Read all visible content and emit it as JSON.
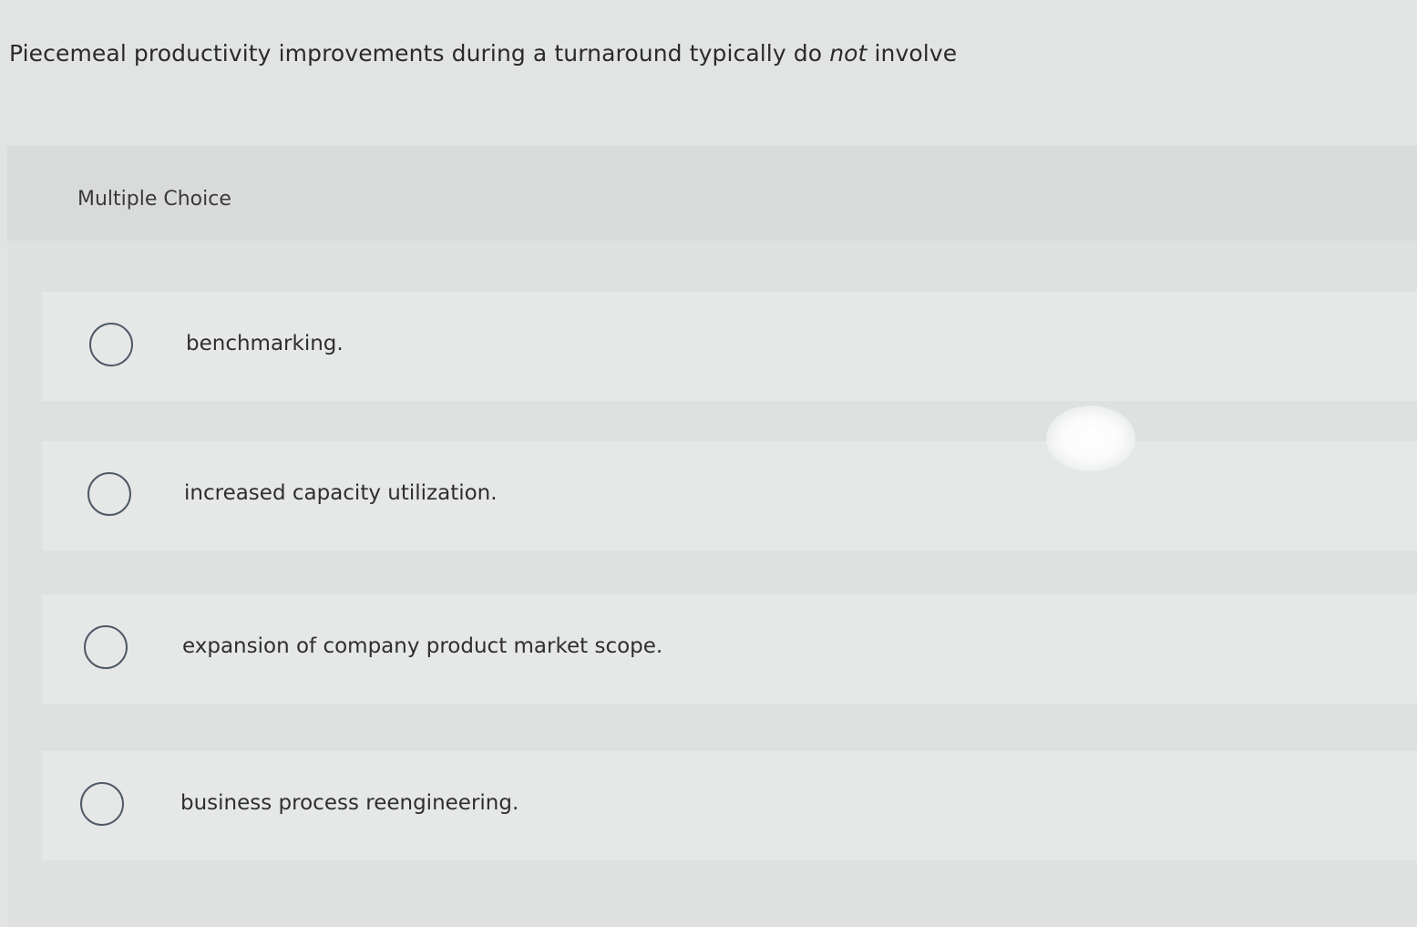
{
  "question": {
    "text_before": "Piecemeal productivity improvements during a turnaround typically do ",
    "emphasis": "not",
    "text_after": " involve"
  },
  "section": {
    "label": "Multiple Choice"
  },
  "choices": [
    {
      "label": "benchmarking.",
      "selected": false
    },
    {
      "label": "increased capacity utilization.",
      "selected": false
    },
    {
      "label": "expansion of company product market scope.",
      "selected": false
    },
    {
      "label": "business process reengineering.",
      "selected": false
    }
  ],
  "colors": {
    "background": "#e2e4e4",
    "radio_border": "#4f5965",
    "text": "#2b2b2b"
  }
}
